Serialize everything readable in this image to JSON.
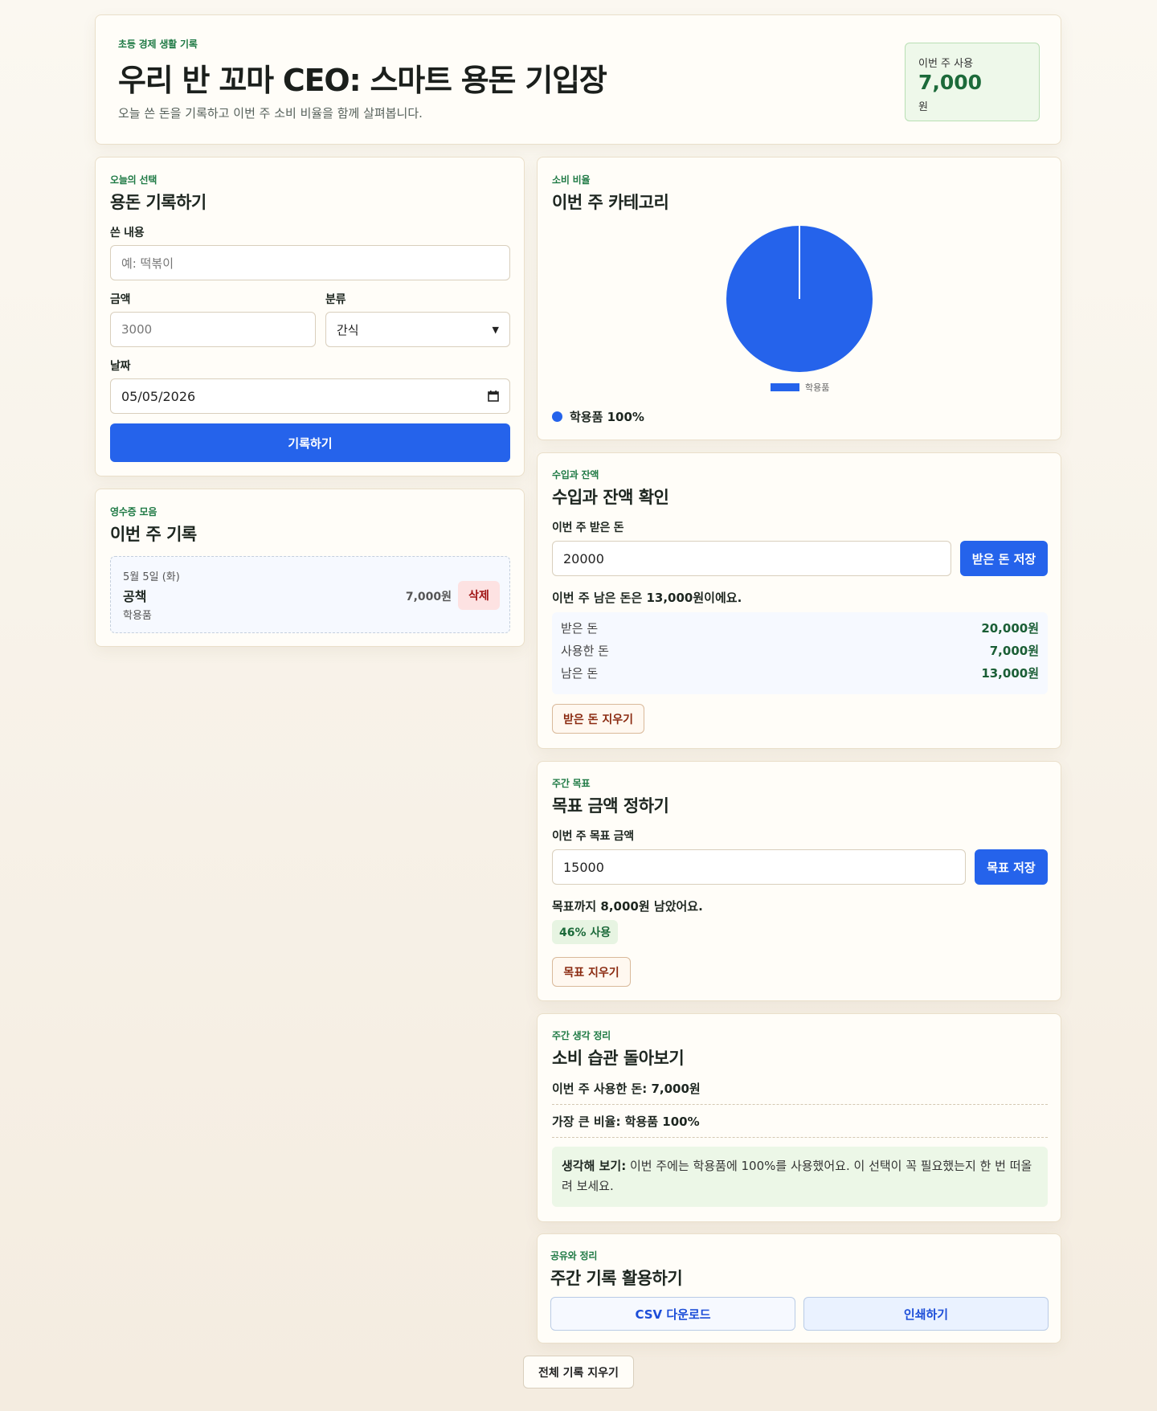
{
  "header": {
    "eyebrow": "초등 경제 생활 기록",
    "title": "우리 반 꼬마 CEO: 스마트 용돈 기입장",
    "subtitle": "오늘 쓴 돈을 기록하고 이번 주 소비 비율을 함께 살펴봅니다.",
    "week_label": "이번 주 사용",
    "week_amount": "7,000",
    "week_unit": "원"
  },
  "record_form": {
    "eyebrow": "오늘의 선택",
    "title": "용돈 기록하기",
    "item_label": "쓴 내용",
    "item_placeholder": "예: 떡볶이",
    "amount_label": "금액",
    "amount_placeholder": "3000",
    "category_label": "분류",
    "category_value": "간식",
    "date_label": "날짜",
    "date_value": "05/05/2026",
    "submit_label": "기록하기"
  },
  "records": {
    "eyebrow": "영수증 모음",
    "title": "이번 주 기록",
    "items": [
      {
        "date": "5월 5일 (화)",
        "name": "공책",
        "category": "학용품",
        "amount": "7,000원",
        "delete_label": "삭제"
      }
    ]
  },
  "chart": {
    "eyebrow": "소비 비율",
    "title": "이번 주 카테고리",
    "legend_label": "학용품",
    "summary": "학용품 100%"
  },
  "chart_data": {
    "type": "pie",
    "categories": [
      "학용품"
    ],
    "values": [
      100
    ],
    "colors": [
      "#2563eb"
    ],
    "legend": [
      "학용품"
    ]
  },
  "income": {
    "eyebrow": "수입과 잔액",
    "title": "수입과 잔액 확인",
    "input_label": "이번 주 받은 돈",
    "input_value": "20000",
    "save_label": "받은 돈 저장",
    "message": "이번 주 남은 돈은 13,000원이에요.",
    "rows": [
      {
        "label": "받은 돈",
        "value": "20,000원"
      },
      {
        "label": "사용한 돈",
        "value": "7,000원"
      },
      {
        "label": "남은 돈",
        "value": "13,000원"
      }
    ],
    "clear_label": "받은 돈 지우기"
  },
  "goal": {
    "eyebrow": "주간 목표",
    "title": "목표 금액 정하기",
    "input_label": "이번 주 목표 금액",
    "input_value": "15000",
    "save_label": "목표 저장",
    "message": "목표까지 8,000원 남았어요.",
    "usage_badge": "46% 사용",
    "clear_label": "목표 지우기"
  },
  "reflection": {
    "eyebrow": "주간 생각 정리",
    "title": "소비 습관 돌아보기",
    "spent": "이번 주 사용한 돈: 7,000원",
    "largest": "가장 큰 비율: 학용품 100%",
    "note_prefix": "생각해 보기:",
    "note_text": " 이번 주에는 학용품에 100%를 사용했어요. 이 선택이 꼭 필요했는지 한 번 떠올려 보세요."
  },
  "share": {
    "eyebrow": "공유와 정리",
    "title": "주간 기록 활용하기",
    "csv_label": "CSV 다운로드",
    "print_label": "인쇄하기"
  },
  "footer": {
    "clear_all_label": "전체 기록 지우기"
  }
}
